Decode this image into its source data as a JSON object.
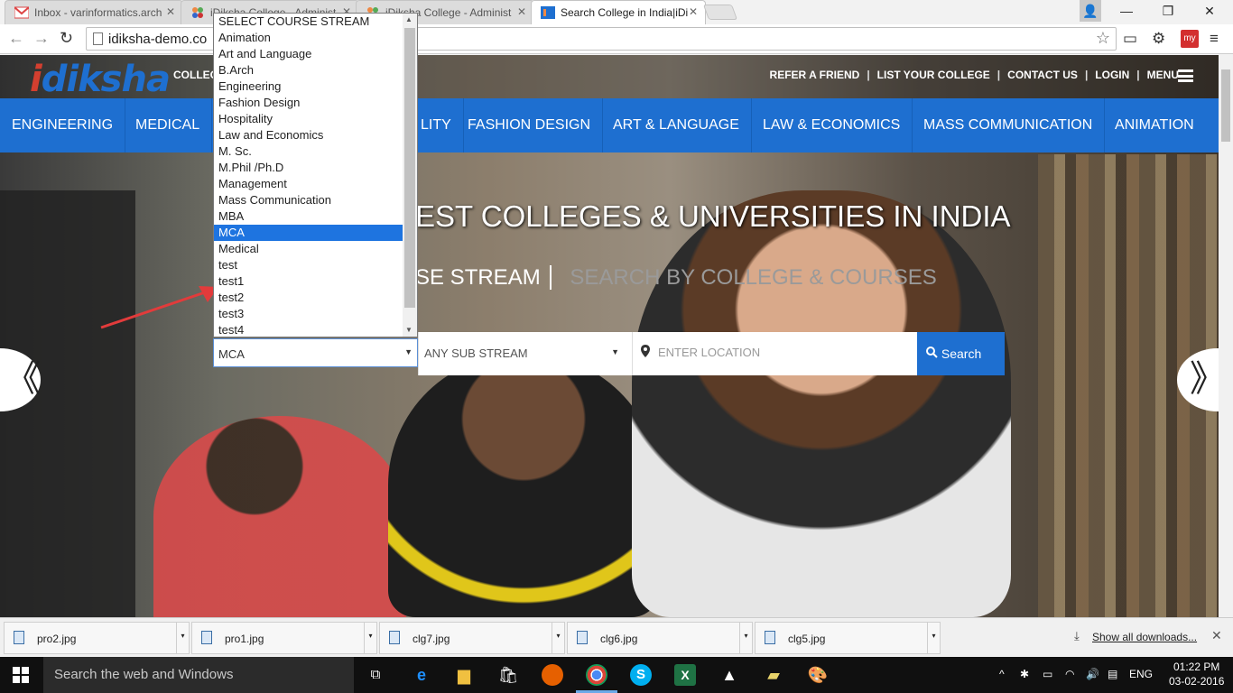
{
  "browser": {
    "tabs": [
      {
        "title": "Inbox - varinformatics.arch",
        "active": false
      },
      {
        "title": "iDiksha College - Administ",
        "active": false
      },
      {
        "title": "iDiksha College - Administ",
        "active": false
      },
      {
        "title": "Search College in India|iDi",
        "active": true
      }
    ],
    "url": "idiksha-demo.co"
  },
  "site": {
    "logo": "idiksha",
    "logo_sub": "COLLEG",
    "top_links": [
      "REFER A FRIEND",
      "LIST YOUR COLLEGE",
      "CONTACT US",
      "LOGIN",
      "MENU"
    ],
    "categories": [
      "ENGINEERING",
      "MEDICAL",
      "LITY",
      "FASHION DESIGN",
      "ART & LANGUAGE",
      "LAW & ECONOMICS",
      "MASS COMMUNICATION",
      "ANIMATION"
    ],
    "hero_title": "EST COLLEGES & UNIVERSITIES IN INDIA",
    "search_tab_active": "SE STREAM",
    "search_tab_other": "SEARCH BY COLLEGE & COURSES",
    "stream_value": "MCA",
    "sub_stream_value": "ANY SUB STREAM",
    "location_placeholder": "ENTER LOCATION",
    "search_label": "Search",
    "carousel_prev": "《",
    "carousel_next": "》"
  },
  "dropdown": {
    "options": [
      "SELECT COURSE STREAM",
      "Animation",
      "Art and Language",
      "B.Arch",
      "Engineering",
      "Fashion Design",
      "Hospitality",
      "Law and Economics",
      "M. Sc.",
      "M.Phil /Ph.D",
      "Management",
      "Mass Communication",
      "MBA",
      "MCA",
      "Medical",
      "test",
      "test1",
      "test2",
      "test3",
      "test4"
    ],
    "selected_index": 13
  },
  "downloads": {
    "files": [
      "pro2.jpg",
      "pro1.jpg",
      "clg7.jpg",
      "clg6.jpg",
      "clg5.jpg"
    ],
    "show_all": "Show all downloads..."
  },
  "taskbar": {
    "search_placeholder": "Search the web and Windows",
    "language": "ENG",
    "time": "01:22 PM",
    "date": "03-02-2016"
  },
  "colors": {
    "brand_blue": "#1e6fd0",
    "selected_blue": "#1e74e0",
    "arrow_red": "#e23b3b"
  }
}
